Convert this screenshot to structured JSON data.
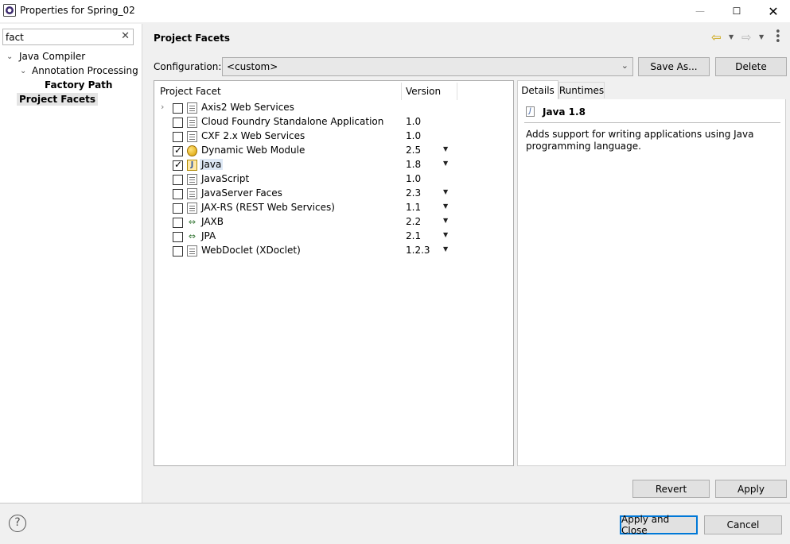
{
  "window": {
    "title": "Properties for Spring_02",
    "minimize_glyph": "—",
    "maximize_glyph": "☐",
    "close_glyph": "✕"
  },
  "sidebar": {
    "filter_value": "fact",
    "clear_glyph": "✕",
    "tree": {
      "java_compiler": "Java Compiler",
      "annotation_processing": "Annotation Processing",
      "factory_path": "Factory Path",
      "project_facets": "Project Facets"
    }
  },
  "main": {
    "title": "Project Facets",
    "configuration_label": "Configuration:",
    "configuration_value": "<custom>",
    "save_as_label": "Save As...",
    "delete_label": "Delete",
    "table": {
      "col_facet": "Project Facet",
      "col_version": "Version",
      "rows": [
        {
          "name": "Axis2 Web Services",
          "version": "",
          "checked": false,
          "icon": "document-icon",
          "dropdown": false
        },
        {
          "name": "Cloud Foundry Standalone Application",
          "version": "1.0",
          "checked": false,
          "icon": "document-icon",
          "dropdown": false
        },
        {
          "name": "CXF 2.x Web Services",
          "version": "1.0",
          "checked": false,
          "icon": "document-icon",
          "dropdown": false
        },
        {
          "name": "Dynamic Web Module",
          "version": "2.5",
          "checked": true,
          "icon": "web-module-icon",
          "dropdown": true
        },
        {
          "name": "Java",
          "version": "1.8",
          "checked": true,
          "icon": "java-icon",
          "dropdown": true
        },
        {
          "name": "JavaScript",
          "version": "1.0",
          "checked": false,
          "icon": "document-icon",
          "dropdown": false
        },
        {
          "name": "JavaServer Faces",
          "version": "2.3",
          "checked": false,
          "icon": "document-icon",
          "dropdown": true
        },
        {
          "name": "JAX-RS (REST Web Services)",
          "version": "1.1",
          "checked": false,
          "icon": "document-icon",
          "dropdown": true
        },
        {
          "name": "JAXB",
          "version": "2.2",
          "checked": false,
          "icon": "arrows-icon",
          "dropdown": true
        },
        {
          "name": "JPA",
          "version": "2.1",
          "checked": false,
          "icon": "arrows-icon",
          "dropdown": true
        },
        {
          "name": "WebDoclet (XDoclet)",
          "version": "1.2.3",
          "checked": false,
          "icon": "document-icon",
          "dropdown": true
        }
      ]
    },
    "details": {
      "tab_details": "Details",
      "tab_runtimes": "Runtimes",
      "title": "Java 1.8",
      "description": "Adds support for writing applications using Java programming language."
    },
    "revert_label": "Revert",
    "apply_label": "Apply"
  },
  "footer": {
    "help_glyph": "?",
    "apply_close_label": "Apply and Close",
    "cancel_label": "Cancel"
  },
  "colors": {
    "accent": "#0078d7",
    "selection": "#dde8f5"
  }
}
